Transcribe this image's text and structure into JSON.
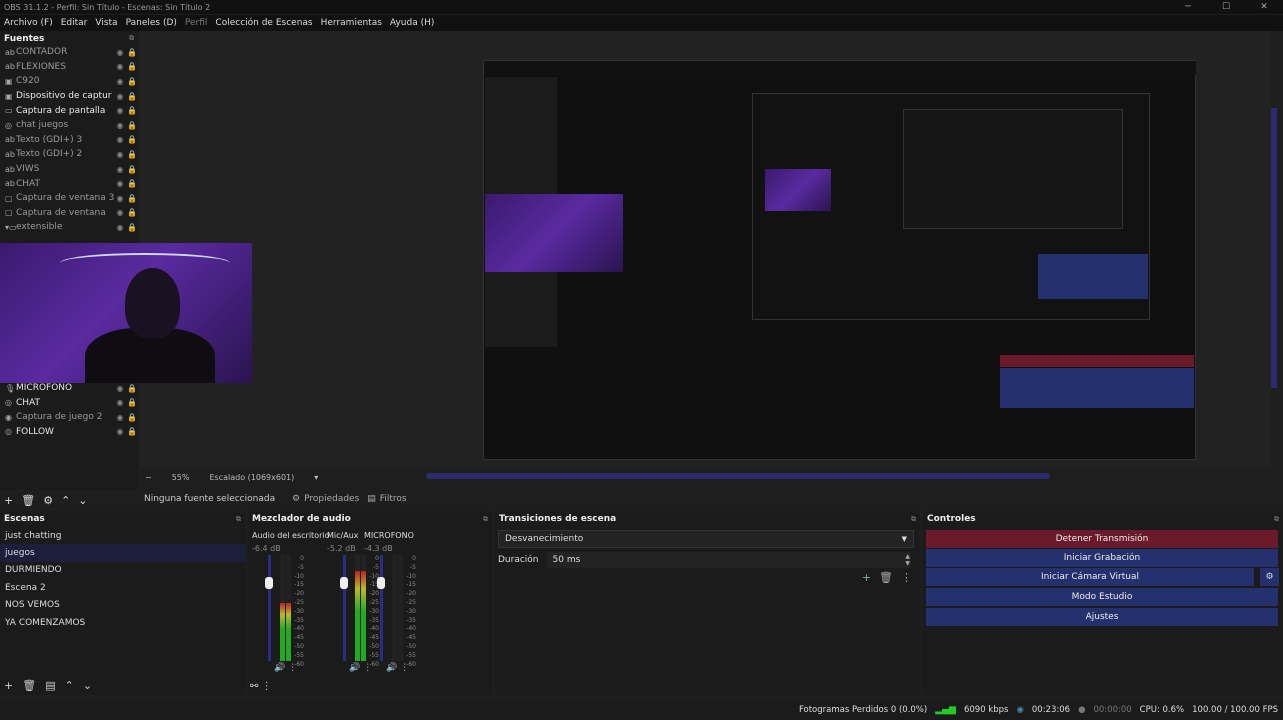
{
  "window": {
    "title": "OBS 31.1.2 - Perfil: Sin Título - Escenas: Sin Título 2"
  },
  "menu": [
    "Archivo (F)",
    "Editar",
    "Vista",
    "Paneles (D)",
    "Perfil",
    "Colección de Escenas",
    "Herramientas",
    "Ayuda (H)"
  ],
  "sources": {
    "title": "Fuentes",
    "items": [
      {
        "label": "CONTADOR",
        "icon": "text-icon"
      },
      {
        "label": "FLEXIONES",
        "icon": "text-icon"
      },
      {
        "label": "C920",
        "icon": "camera-icon"
      },
      {
        "label": "Dispositivo de captur",
        "icon": "camera-icon"
      },
      {
        "label": "Captura de pantalla",
        "icon": "monitor-icon"
      },
      {
        "label": "chat juegos",
        "icon": "browser-icon"
      },
      {
        "label": "Texto (GDI+) 3",
        "icon": "text-icon"
      },
      {
        "label": "Texto (GDI+) 2",
        "icon": "text-icon"
      },
      {
        "label": "VIWS",
        "icon": "text-icon"
      },
      {
        "label": "CHAT",
        "icon": "text-icon"
      },
      {
        "label": "Captura de ventana 3",
        "icon": "window-icon"
      },
      {
        "label": "Captura de ventana",
        "icon": "window-icon"
      },
      {
        "label": "extensible",
        "icon": "folder-icon"
      },
      {
        "label": "MICROFONO",
        "icon": "mic-icon"
      },
      {
        "label": "CHAT",
        "icon": "browser-icon"
      },
      {
        "label": "Captura de juego 2",
        "icon": "gamepad-icon"
      },
      {
        "label": "FOLLOW",
        "icon": "browser-icon"
      }
    ]
  },
  "preview": {
    "zoom": "55%",
    "scale": "Escalado (1069x601)"
  },
  "properties_bar": {
    "no_source": "Ninguna fuente seleccionada",
    "properties": "Propiedades",
    "filters": "Filtros"
  },
  "scenes": {
    "title": "Escenas",
    "items": [
      "just chatting",
      "juegos",
      "DURMIENDO",
      "Escena 2",
      "NOS VEMOS",
      "YA COMENZAMOS"
    ]
  },
  "mixer": {
    "title": "Mezclador de audio",
    "channels": [
      {
        "name": "Audio del escritorio",
        "db": "-6.4 dB",
        "level": 0.55
      },
      {
        "name": "Mic/Aux",
        "db": "-5.2 dB",
        "level": 0.85
      },
      {
        "name": "MICROFONO",
        "db": "-4.3 dB",
        "level": 0.0
      }
    ],
    "ticks": [
      "0",
      "-5",
      "-10",
      "-15",
      "-20",
      "-25",
      "-30",
      "-35",
      "-40",
      "-45",
      "-50",
      "-55",
      "-60"
    ]
  },
  "transitions": {
    "title": "Transiciones de escena",
    "type": "Desvanecimiento",
    "duration_label": "Duración",
    "duration_value": "50 ms"
  },
  "controls": {
    "title": "Controles",
    "stop_stream": "Detener Transmisión",
    "start_recording": "Iniciar Grabación",
    "virtual_cam": "Iniciar Cámara Virtual",
    "studio_mode": "Modo Estudio",
    "settings": "Ajustes",
    "colors": {
      "stop": "#6a1a2a",
      "primary": "#25306e"
    }
  },
  "status": {
    "dropped": "Fotogramas Perdidos 0 (0.0%)",
    "bitrate": "6090 kbps",
    "stream_time": "00:23:06",
    "rec_time": "00:00:00",
    "cpu": "CPU: 0.6%",
    "fps": "100.00 / 100.00 FPS"
  }
}
